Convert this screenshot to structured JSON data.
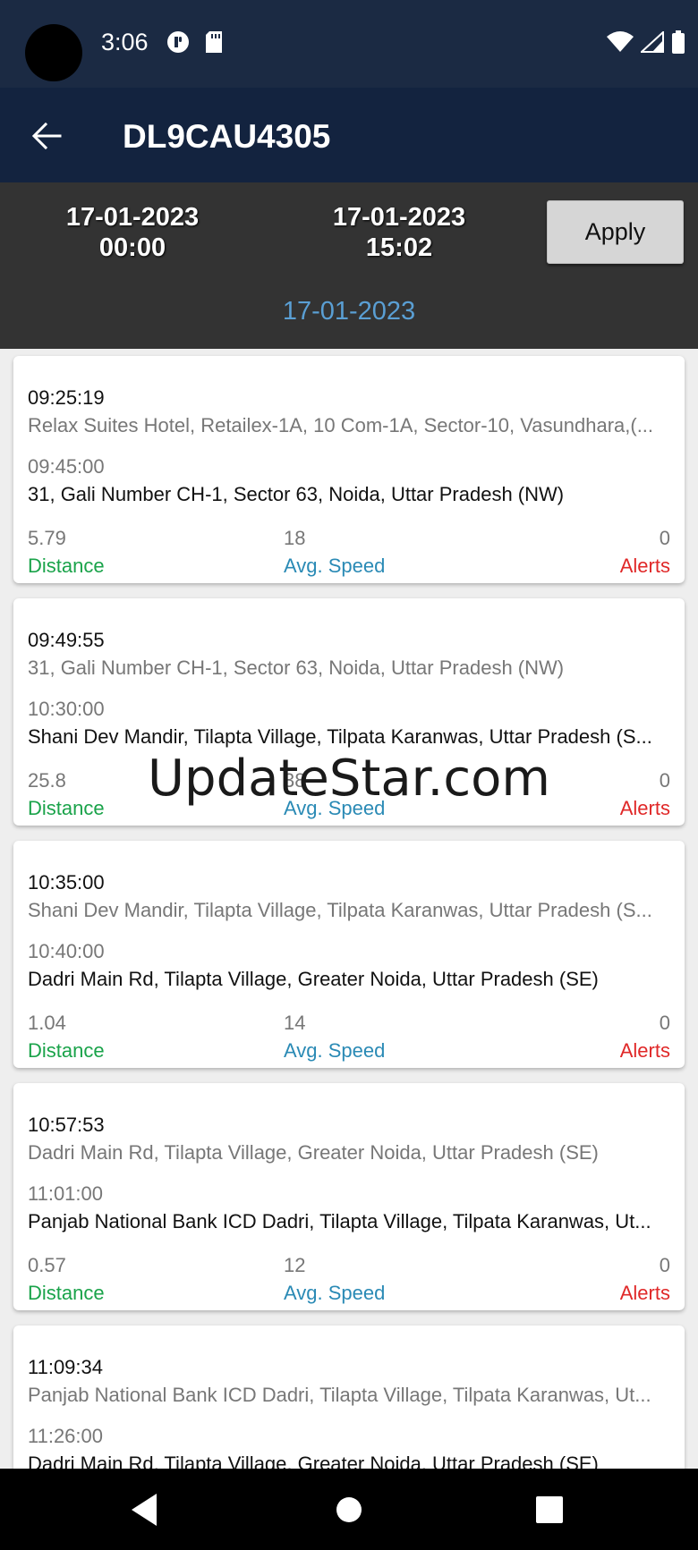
{
  "status_bar": {
    "time": "3:06",
    "icons_left": [
      "data-saver-icon",
      "sd-card-icon"
    ],
    "icons_right": [
      "wifi-icon",
      "signal-icon",
      "battery-icon"
    ]
  },
  "app_bar": {
    "title": "DL9CAU4305",
    "back_icon": "arrow-left-icon"
  },
  "filter": {
    "from_date": "17-01-2023",
    "from_time": "00:00",
    "to_date": "17-01-2023",
    "to_time": "15:02",
    "apply_label": "Apply",
    "selected_date": "17-01-2023"
  },
  "trips": [
    {
      "start_time": "09:25:19",
      "start_address": "Relax Suites Hotel, Retailex-1A, 10 Com-1A, Sector-10, Vasundhara,(...",
      "end_time": "09:45:00",
      "end_address": "31, Gali Number CH-1, Sector 63, Noida, Uttar Pradesh (NW)",
      "distance": "5.79",
      "avg_speed": "18",
      "alerts": "0"
    },
    {
      "start_time": "09:49:55",
      "start_address": "31, Gali Number CH-1, Sector 63, Noida, Uttar Pradesh (NW)",
      "end_time": "10:30:00",
      "end_address": "Shani Dev Mandir, Tilapta Village, Tilpata Karanwas, Uttar Pradesh (S...",
      "distance": "25.8",
      "avg_speed": "38",
      "alerts": "0"
    },
    {
      "start_time": "10:35:00",
      "start_address": "Shani Dev Mandir, Tilapta Village, Tilpata Karanwas, Uttar Pradesh (S...",
      "end_time": "10:40:00",
      "end_address": "Dadri Main Rd, Tilapta Village, Greater Noida, Uttar Pradesh (SE)",
      "distance": "1.04",
      "avg_speed": "14",
      "alerts": "0"
    },
    {
      "start_time": "10:57:53",
      "start_address": "Dadri Main Rd, Tilapta Village, Greater Noida, Uttar Pradesh (SE)",
      "end_time": "11:01:00",
      "end_address": "Panjab National Bank ICD Dadri, Tilapta Village, Tilpata Karanwas, Ut...",
      "distance": "0.57",
      "avg_speed": "12",
      "alerts": "0"
    },
    {
      "start_time": "11:09:34",
      "start_address": "Panjab National Bank ICD Dadri, Tilapta Village, Tilpata Karanwas, Ut...",
      "end_time": "11:26:00",
      "end_address": "Dadri Main Rd, Tilapta Village, Greater Noida, Uttar Pradesh (SE)",
      "distance": "",
      "avg_speed": "",
      "alerts": ""
    }
  ],
  "labels": {
    "distance": "Distance",
    "avg_speed": "Avg. Speed",
    "alerts": "Alerts"
  },
  "colors": {
    "distance": "#1aa34a",
    "avg_speed": "#2a8ab5",
    "alerts": "#e02828",
    "header": "#13233f",
    "selected_date": "#5a9fd4"
  },
  "watermark": "UpdateStar.com",
  "nav_bar": {
    "icons": [
      "nav-back-icon",
      "nav-home-icon",
      "nav-recents-icon"
    ]
  }
}
